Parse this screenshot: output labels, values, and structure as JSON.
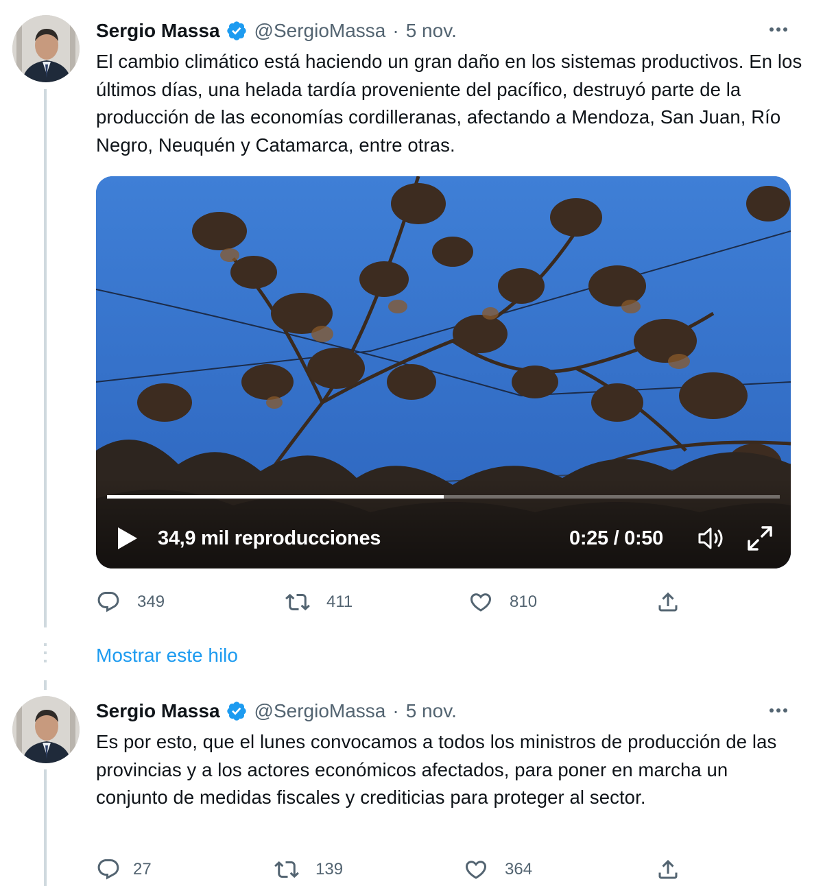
{
  "colors": {
    "verified": "#1d9bf0",
    "link": "#1d9bf0",
    "secondary_text": "#536471",
    "thread_line": "#cfd9de"
  },
  "tweets": [
    {
      "author_name": "Sergio Massa",
      "handle": "@SergioMassa",
      "separator": "·",
      "date": "5 nov.",
      "text": "El cambio climático está haciendo un gran daño en los sistemas productivos. En los últimos días, una helada tardía proveniente del pacífico, destruyó parte de la producción de las economías cordilleranas, afectando a Mendoza, San Juan, Río Negro, Neuquén y Catamarca, entre otras.",
      "video": {
        "views": "34,9 mil reproducciones",
        "time": "0:25 / 0:50",
        "progress_fraction": 0.5
      },
      "actions": {
        "replies": "349",
        "retweets": "411",
        "likes": "810"
      }
    },
    {
      "author_name": "Sergio Massa",
      "handle": "@SergioMassa",
      "separator": "·",
      "date": "5 nov.",
      "text": "Es por esto, que el lunes convocamos a todos los ministros de producción de las provincias y a los actores económicos afectados, para poner en marcha un conjunto de medidas fiscales y crediticias para proteger al sector.",
      "actions": {
        "replies": "27",
        "retweets": "139",
        "likes": "364"
      }
    }
  ],
  "show_thread_label": "Mostrar este hilo",
  "icons": {
    "verified": "verified-badge-icon",
    "more": "more-dots-icon",
    "reply": "reply-bubble-icon",
    "retweet": "retweet-arrows-icon",
    "like": "heart-icon",
    "share": "share-upload-icon",
    "play": "play-icon",
    "volume": "volume-icon",
    "fullscreen": "fullscreen-icon"
  }
}
